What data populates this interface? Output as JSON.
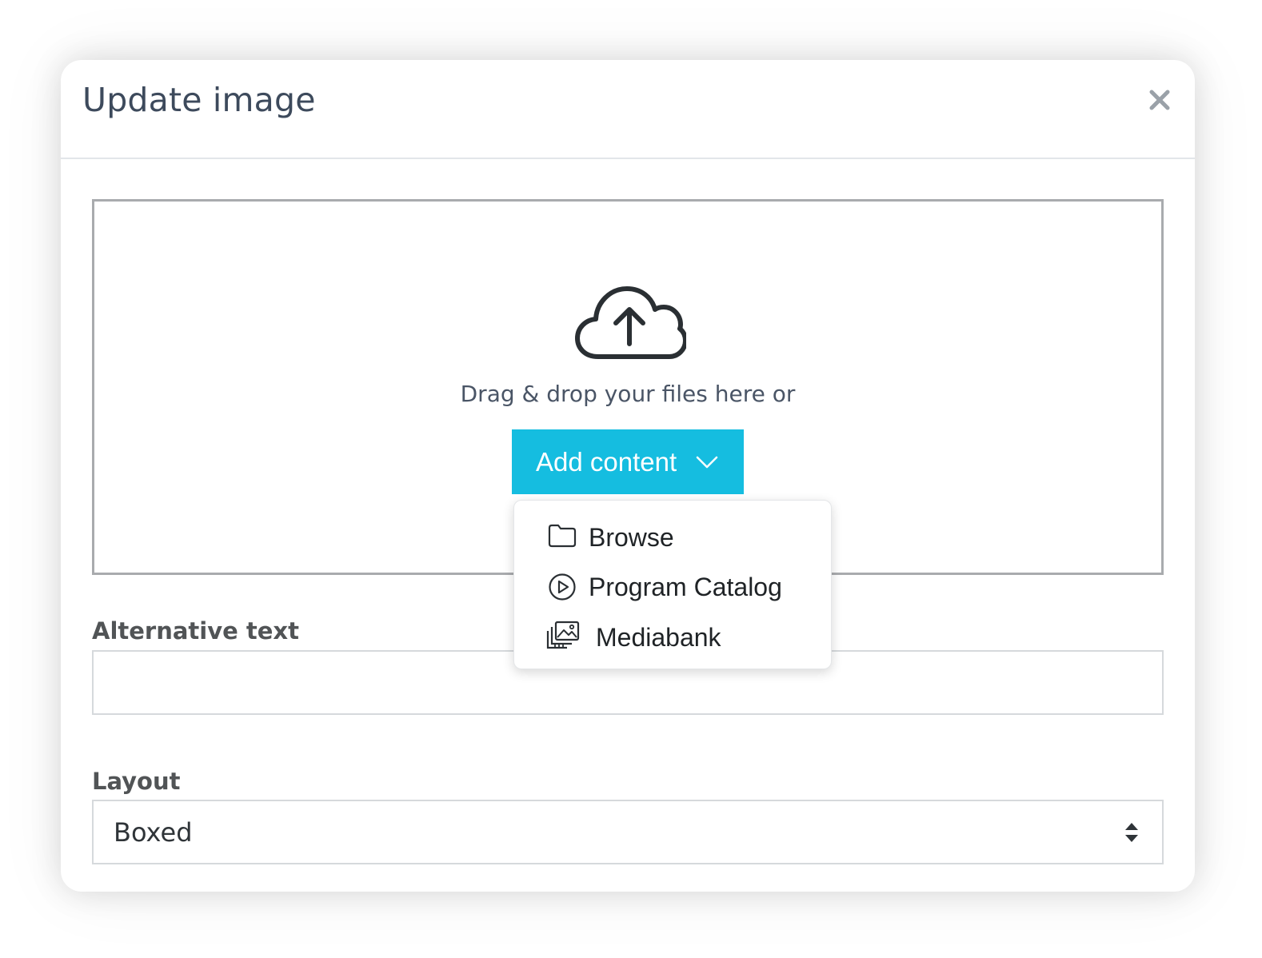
{
  "dialog": {
    "title": "Update image",
    "close_icon": "close-icon"
  },
  "dropzone": {
    "icon": "cloud-upload-icon",
    "text": "Drag & drop your files here or",
    "add_content_label": "Add content",
    "add_content_color": "#15bde0"
  },
  "menu": {
    "items": [
      {
        "label": "Browse",
        "icon": "folder-icon"
      },
      {
        "label": "Program Catalog",
        "icon": "play-circle-icon"
      },
      {
        "label": "Mediabank",
        "icon": "image-gallery-icon"
      }
    ]
  },
  "fields": {
    "alt_text": {
      "label": "Alternative text",
      "value": "",
      "placeholder": ""
    },
    "layout": {
      "label": "Layout",
      "value": "Boxed"
    }
  }
}
